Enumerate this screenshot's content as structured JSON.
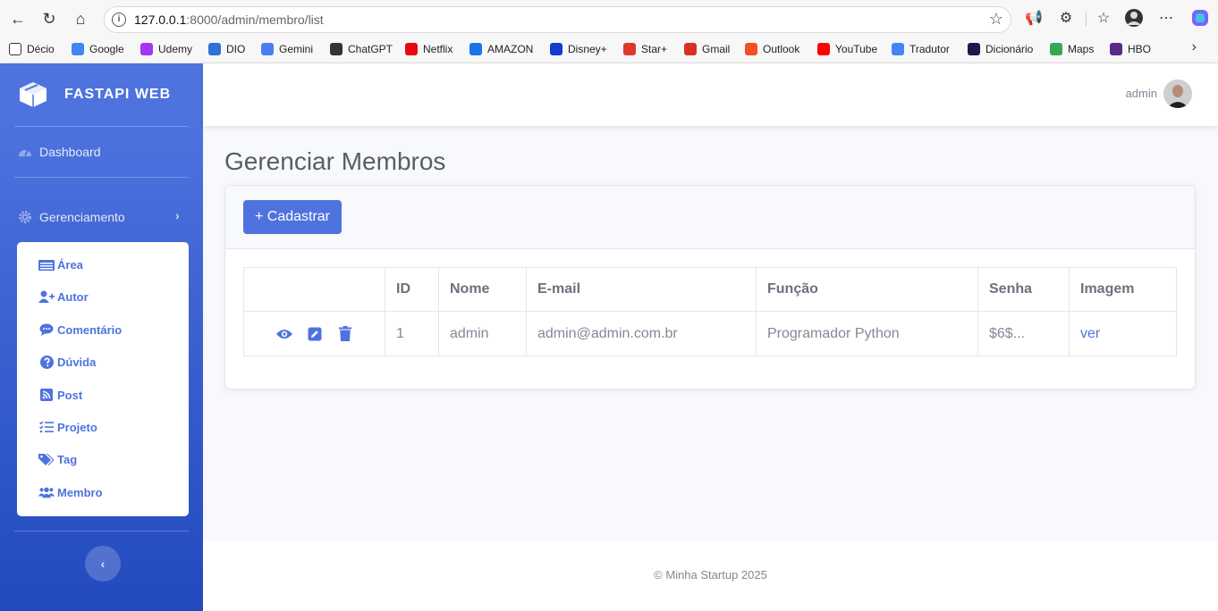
{
  "browser": {
    "url_host": "127.0.0.1",
    "url_rest": ":8000/admin/membro/list",
    "bookmarks": [
      {
        "label": "Décio",
        "color": "#ffffff"
      },
      {
        "label": "Google",
        "color": "#4285f4"
      },
      {
        "label": "Udemy",
        "color": "#a435f0"
      },
      {
        "label": "DIO",
        "color": "#2f6fd6"
      },
      {
        "label": "Gemini",
        "color": "#4a7ef0"
      },
      {
        "label": "ChatGPT",
        "color": "#333333"
      },
      {
        "label": "Netflix",
        "color": "#e50914"
      },
      {
        "label": "AMAZON",
        "color": "#1a73e8"
      },
      {
        "label": "Disney+",
        "color": "#113ccf"
      },
      {
        "label": "Star+",
        "color": "#e0362c"
      },
      {
        "label": "Gmail",
        "color": "#d93025"
      },
      {
        "label": "Outlook",
        "color": "#f25022"
      },
      {
        "label": "YouTube",
        "color": "#ff0000"
      },
      {
        "label": "Tradutor",
        "color": "#4285f4"
      },
      {
        "label": "Dicionário",
        "color": "#1a1a4a"
      },
      {
        "label": "Maps",
        "color": "#34a853"
      },
      {
        "label": "HBO",
        "color": "#5b2a86"
      }
    ]
  },
  "brand": {
    "name": "FASTAPI WEB"
  },
  "sidebar": {
    "dashboard": "Dashboard",
    "management": "Gerenciamento",
    "items": [
      {
        "label": "Área",
        "icon": "building-icon"
      },
      {
        "label": "Autor",
        "icon": "user-plus-icon"
      },
      {
        "label": "Comentário",
        "icon": "comment-icon"
      },
      {
        "label": "Dúvida",
        "icon": "question-circle-icon"
      },
      {
        "label": "Post",
        "icon": "rss-icon"
      },
      {
        "label": "Projeto",
        "icon": "tasks-icon"
      },
      {
        "label": "Tag",
        "icon": "tags-icon"
      },
      {
        "label": "Membro",
        "icon": "users-icon"
      }
    ]
  },
  "topbar": {
    "user": "admin"
  },
  "page": {
    "title": "Gerenciar Membros",
    "add_button": "+ Cadastrar"
  },
  "table": {
    "headers": [
      "",
      "ID",
      "Nome",
      "E-mail",
      "Função",
      "Senha",
      "Imagem"
    ],
    "rows": [
      {
        "id": "1",
        "nome": "admin",
        "email": "admin@admin.com.br",
        "funcao": "Programador Python",
        "senha": "$6$...",
        "imagem": "ver"
      }
    ]
  },
  "footer": {
    "text": "© Minha Startup 2025"
  }
}
